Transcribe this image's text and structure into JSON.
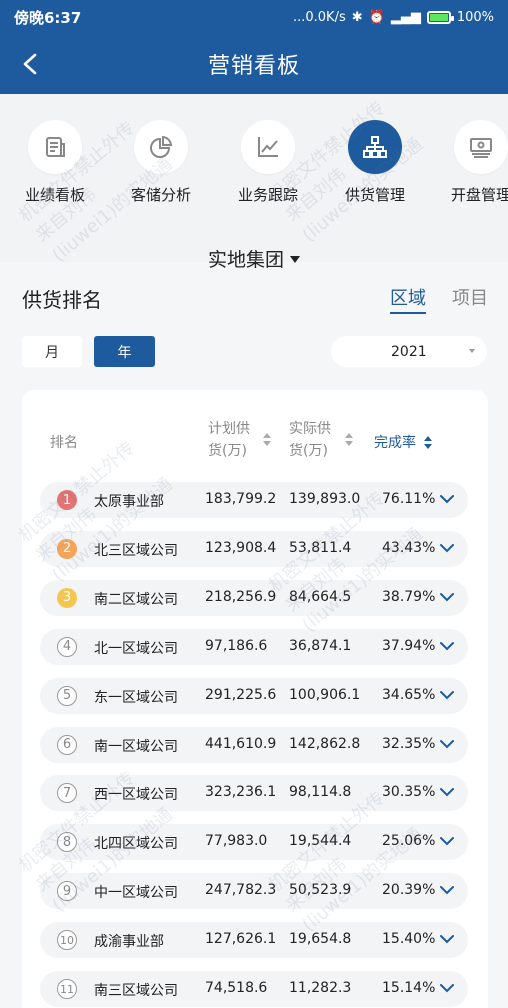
{
  "status_bar": {
    "time": "傍晚6:37",
    "network_speed": "...0.0K/s",
    "battery_pct": "100%",
    "battery_level": 1.0
  },
  "header": {
    "title": "营销看板",
    "back_icon": "chevron-left-icon"
  },
  "nav": {
    "items": [
      {
        "label": "业绩看板",
        "icon": "document-icon",
        "active": false
      },
      {
        "label": "客储分析",
        "icon": "pie-chart-icon",
        "active": false
      },
      {
        "label": "业务跟踪",
        "icon": "line-chart-icon",
        "active": false
      },
      {
        "label": "供货管理",
        "icon": "hierarchy-icon",
        "active": true
      },
      {
        "label": "开盘管理",
        "icon": "cash-icon",
        "active": false
      }
    ]
  },
  "group_selector": {
    "label": "实地集团"
  },
  "section": {
    "title": "供货排名",
    "tabs": [
      {
        "label": "区域",
        "active": true
      },
      {
        "label": "项目",
        "active": false
      }
    ]
  },
  "period": {
    "month_label": "月",
    "year_label": "年",
    "selected": "年"
  },
  "year_select": {
    "value": "2021"
  },
  "table": {
    "headers": {
      "rank": "排名",
      "plan_line1": "计划供",
      "plan_line2": "货(万)",
      "actual_line1": "实际供",
      "actual_line2": "货(万)",
      "rate": "完成率"
    },
    "rows": [
      {
        "rank": "1",
        "name": "太原事业部",
        "plan": "183,799.2",
        "actual": "139,893.0",
        "rate": "76.11%"
      },
      {
        "rank": "2",
        "name": "北三区域公司",
        "plan": "123,908.4",
        "actual": "53,811.4",
        "rate": "43.43%"
      },
      {
        "rank": "3",
        "name": "南二区域公司",
        "plan": "218,256.9",
        "actual": "84,664.5",
        "rate": "38.79%"
      },
      {
        "rank": "4",
        "name": "北一区域公司",
        "plan": "97,186.6",
        "actual": "36,874.1",
        "rate": "37.94%"
      },
      {
        "rank": "5",
        "name": "东一区域公司",
        "plan": "291,225.6",
        "actual": "100,906.1",
        "rate": "34.65%"
      },
      {
        "rank": "6",
        "name": "南一区域公司",
        "plan": "441,610.9",
        "actual": "142,862.8",
        "rate": "32.35%"
      },
      {
        "rank": "7",
        "name": "西一区域公司",
        "plan": "323,236.1",
        "actual": "98,114.8",
        "rate": "30.35%"
      },
      {
        "rank": "8",
        "name": "北四区域公司",
        "plan": "77,983.0",
        "actual": "19,544.4",
        "rate": "25.06%"
      },
      {
        "rank": "9",
        "name": "中一区域公司",
        "plan": "247,782.3",
        "actual": "50,523.9",
        "rate": "20.39%"
      },
      {
        "rank": "10",
        "name": "成渝事业部",
        "plan": "127,626.1",
        "actual": "19,654.8",
        "rate": "15.40%"
      },
      {
        "rank": "11",
        "name": "南三区域公司",
        "plan": "74,518.6",
        "actual": "11,282.3",
        "rate": "15.14%"
      }
    ]
  },
  "colors": {
    "primary": "#1e5b9e",
    "rank1": "#e57373",
    "rank2": "#f5a55a",
    "rank3": "#f5c64f"
  },
  "watermark": {
    "line1": "机密文件禁止外传",
    "line2": "来自刘伟",
    "line3": "(liuwei1)的实地通"
  }
}
